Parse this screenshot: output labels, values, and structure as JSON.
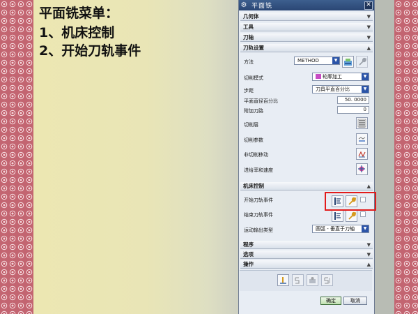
{
  "slide": {
    "title": "平面铣菜单：",
    "items": [
      "1、机床控制",
      "2、开始刀轨事件"
    ]
  },
  "dialog": {
    "title": "平面铣",
    "sections": {
      "geometry": "几何体",
      "tool": "工具",
      "tool_axis": "刀轴",
      "path_settings": "刀轨设置",
      "machine_control": "机床控制",
      "program": "程序",
      "options": "选项",
      "actions": "操作"
    },
    "path_settings": {
      "method_label": "方法",
      "method_value": "METHOD",
      "cut_mode_label": "切削模式",
      "cut_mode_value": "轮廓加工",
      "stepover_label": "步距",
      "stepover_value": "刀具平直百分比",
      "flat_diameter_label": "平面直径百分比",
      "flat_diameter_value": "50. 0000",
      "additional_passes_label": "附加刀路",
      "additional_passes_value": "0",
      "cut_levels_label": "切削层",
      "cut_params_label": "切削参数",
      "non_cutting_label": "非切削移动",
      "feeds_label": "进给率和速度"
    },
    "machine_control": {
      "start_event_label": "开始刀轨事件",
      "end_event_label": "结束刀轨事件",
      "motion_output_label": "运动输出类型",
      "motion_output_value": "圆弧 - 垂直于刀轴"
    },
    "buttons": {
      "ok": "确定",
      "cancel": "取消"
    }
  },
  "colors": {
    "highlight": "#e21b1b",
    "title_bar": "#2f4d7c",
    "dropdown_arrow": "#2b54a8"
  }
}
